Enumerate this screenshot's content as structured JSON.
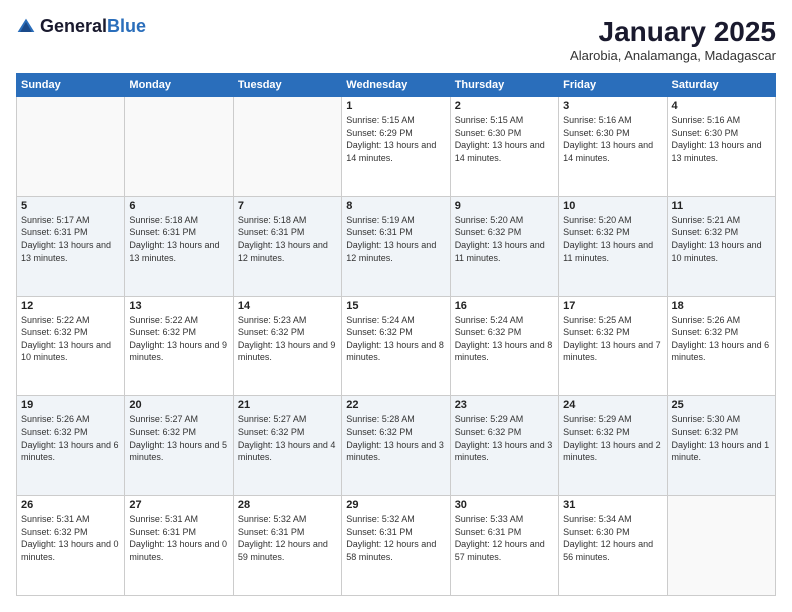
{
  "logo": {
    "text_general": "General",
    "text_blue": "Blue"
  },
  "header": {
    "title": "January 2025",
    "subtitle": "Alarobia, Analamanga, Madagascar"
  },
  "weekdays": [
    "Sunday",
    "Monday",
    "Tuesday",
    "Wednesday",
    "Thursday",
    "Friday",
    "Saturday"
  ],
  "weeks": [
    [
      {
        "day": "",
        "empty": true
      },
      {
        "day": "",
        "empty": true
      },
      {
        "day": "",
        "empty": true
      },
      {
        "day": "1",
        "sunrise": "Sunrise: 5:15 AM",
        "sunset": "Sunset: 6:29 PM",
        "daylight": "Daylight: 13 hours and 14 minutes."
      },
      {
        "day": "2",
        "sunrise": "Sunrise: 5:15 AM",
        "sunset": "Sunset: 6:30 PM",
        "daylight": "Daylight: 13 hours and 14 minutes."
      },
      {
        "day": "3",
        "sunrise": "Sunrise: 5:16 AM",
        "sunset": "Sunset: 6:30 PM",
        "daylight": "Daylight: 13 hours and 14 minutes."
      },
      {
        "day": "4",
        "sunrise": "Sunrise: 5:16 AM",
        "sunset": "Sunset: 6:30 PM",
        "daylight": "Daylight: 13 hours and 13 minutes."
      }
    ],
    [
      {
        "day": "5",
        "sunrise": "Sunrise: 5:17 AM",
        "sunset": "Sunset: 6:31 PM",
        "daylight": "Daylight: 13 hours and 13 minutes."
      },
      {
        "day": "6",
        "sunrise": "Sunrise: 5:18 AM",
        "sunset": "Sunset: 6:31 PM",
        "daylight": "Daylight: 13 hours and 13 minutes."
      },
      {
        "day": "7",
        "sunrise": "Sunrise: 5:18 AM",
        "sunset": "Sunset: 6:31 PM",
        "daylight": "Daylight: 13 hours and 12 minutes."
      },
      {
        "day": "8",
        "sunrise": "Sunrise: 5:19 AM",
        "sunset": "Sunset: 6:31 PM",
        "daylight": "Daylight: 13 hours and 12 minutes."
      },
      {
        "day": "9",
        "sunrise": "Sunrise: 5:20 AM",
        "sunset": "Sunset: 6:32 PM",
        "daylight": "Daylight: 13 hours and 11 minutes."
      },
      {
        "day": "10",
        "sunrise": "Sunrise: 5:20 AM",
        "sunset": "Sunset: 6:32 PM",
        "daylight": "Daylight: 13 hours and 11 minutes."
      },
      {
        "day": "11",
        "sunrise": "Sunrise: 5:21 AM",
        "sunset": "Sunset: 6:32 PM",
        "daylight": "Daylight: 13 hours and 10 minutes."
      }
    ],
    [
      {
        "day": "12",
        "sunrise": "Sunrise: 5:22 AM",
        "sunset": "Sunset: 6:32 PM",
        "daylight": "Daylight: 13 hours and 10 minutes."
      },
      {
        "day": "13",
        "sunrise": "Sunrise: 5:22 AM",
        "sunset": "Sunset: 6:32 PM",
        "daylight": "Daylight: 13 hours and 9 minutes."
      },
      {
        "day": "14",
        "sunrise": "Sunrise: 5:23 AM",
        "sunset": "Sunset: 6:32 PM",
        "daylight": "Daylight: 13 hours and 9 minutes."
      },
      {
        "day": "15",
        "sunrise": "Sunrise: 5:24 AM",
        "sunset": "Sunset: 6:32 PM",
        "daylight": "Daylight: 13 hours and 8 minutes."
      },
      {
        "day": "16",
        "sunrise": "Sunrise: 5:24 AM",
        "sunset": "Sunset: 6:32 PM",
        "daylight": "Daylight: 13 hours and 8 minutes."
      },
      {
        "day": "17",
        "sunrise": "Sunrise: 5:25 AM",
        "sunset": "Sunset: 6:32 PM",
        "daylight": "Daylight: 13 hours and 7 minutes."
      },
      {
        "day": "18",
        "sunrise": "Sunrise: 5:26 AM",
        "sunset": "Sunset: 6:32 PM",
        "daylight": "Daylight: 13 hours and 6 minutes."
      }
    ],
    [
      {
        "day": "19",
        "sunrise": "Sunrise: 5:26 AM",
        "sunset": "Sunset: 6:32 PM",
        "daylight": "Daylight: 13 hours and 6 minutes."
      },
      {
        "day": "20",
        "sunrise": "Sunrise: 5:27 AM",
        "sunset": "Sunset: 6:32 PM",
        "daylight": "Daylight: 13 hours and 5 minutes."
      },
      {
        "day": "21",
        "sunrise": "Sunrise: 5:27 AM",
        "sunset": "Sunset: 6:32 PM",
        "daylight": "Daylight: 13 hours and 4 minutes."
      },
      {
        "day": "22",
        "sunrise": "Sunrise: 5:28 AM",
        "sunset": "Sunset: 6:32 PM",
        "daylight": "Daylight: 13 hours and 3 minutes."
      },
      {
        "day": "23",
        "sunrise": "Sunrise: 5:29 AM",
        "sunset": "Sunset: 6:32 PM",
        "daylight": "Daylight: 13 hours and 3 minutes."
      },
      {
        "day": "24",
        "sunrise": "Sunrise: 5:29 AM",
        "sunset": "Sunset: 6:32 PM",
        "daylight": "Daylight: 13 hours and 2 minutes."
      },
      {
        "day": "25",
        "sunrise": "Sunrise: 5:30 AM",
        "sunset": "Sunset: 6:32 PM",
        "daylight": "Daylight: 13 hours and 1 minute."
      }
    ],
    [
      {
        "day": "26",
        "sunrise": "Sunrise: 5:31 AM",
        "sunset": "Sunset: 6:32 PM",
        "daylight": "Daylight: 13 hours and 0 minutes."
      },
      {
        "day": "27",
        "sunrise": "Sunrise: 5:31 AM",
        "sunset": "Sunset: 6:31 PM",
        "daylight": "Daylight: 13 hours and 0 minutes."
      },
      {
        "day": "28",
        "sunrise": "Sunrise: 5:32 AM",
        "sunset": "Sunset: 6:31 PM",
        "daylight": "Daylight: 12 hours and 59 minutes."
      },
      {
        "day": "29",
        "sunrise": "Sunrise: 5:32 AM",
        "sunset": "Sunset: 6:31 PM",
        "daylight": "Daylight: 12 hours and 58 minutes."
      },
      {
        "day": "30",
        "sunrise": "Sunrise: 5:33 AM",
        "sunset": "Sunset: 6:31 PM",
        "daylight": "Daylight: 12 hours and 57 minutes."
      },
      {
        "day": "31",
        "sunrise": "Sunrise: 5:34 AM",
        "sunset": "Sunset: 6:30 PM",
        "daylight": "Daylight: 12 hours and 56 minutes."
      },
      {
        "day": "",
        "empty": true
      }
    ]
  ]
}
